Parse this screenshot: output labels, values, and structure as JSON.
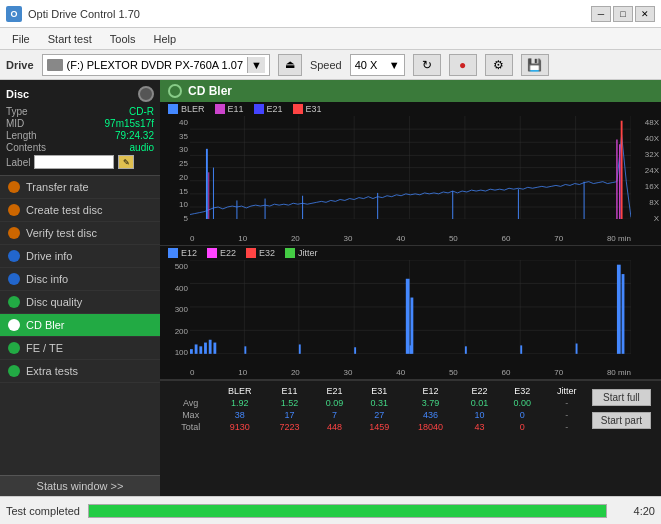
{
  "titlebar": {
    "title": "Opti Drive Control 1.70",
    "icon_label": "O",
    "minimize": "─",
    "maximize": "□",
    "close": "✕"
  },
  "menubar": {
    "items": [
      "File",
      "Start test",
      "Tools",
      "Help"
    ]
  },
  "drivebar": {
    "label": "Drive",
    "drive_text": "(F:)  PLEXTOR DVDR  PX-760A 1.07",
    "speed_label": "Speed",
    "speed_value": "40 X",
    "dropdown_arrow": "▼"
  },
  "disc": {
    "title": "Disc",
    "type_label": "Type",
    "type_value": "CD-R",
    "mid_label": "MID",
    "mid_value": "97m15s17f",
    "length_label": "Length",
    "length_value": "79:24.32",
    "contents_label": "Contents",
    "contents_value": "audio",
    "label_label": "Label"
  },
  "nav": {
    "items": [
      {
        "id": "transfer-rate",
        "label": "Transfer rate",
        "dot_type": "orange"
      },
      {
        "id": "create-test-disc",
        "label": "Create test disc",
        "dot_type": "orange"
      },
      {
        "id": "verify-test-disc",
        "label": "Verify test disc",
        "dot_type": "orange"
      },
      {
        "id": "drive-info",
        "label": "Drive info",
        "dot_type": "blue"
      },
      {
        "id": "disc-info",
        "label": "Disc info",
        "dot_type": "blue"
      },
      {
        "id": "disc-quality",
        "label": "Disc quality",
        "dot_type": "green"
      },
      {
        "id": "cd-bler",
        "label": "CD Bler",
        "dot_type": "active",
        "active": true
      },
      {
        "id": "fe-te",
        "label": "FE / TE",
        "dot_type": "green"
      },
      {
        "id": "extra-tests",
        "label": "Extra tests",
        "dot_type": "green"
      }
    ],
    "status_btn": "Status window >>"
  },
  "chart": {
    "title": "CD Bler",
    "legend1": [
      {
        "label": "BLER",
        "color": "#4488ff"
      },
      {
        "label": "E11",
        "color": "#cc44cc"
      },
      {
        "label": "E21",
        "color": "#4444ff"
      },
      {
        "label": "E31",
        "color": "#ff4444"
      }
    ],
    "legend2": [
      {
        "label": "E12",
        "color": "#4488ff"
      },
      {
        "label": "E22",
        "color": "#ff44ff"
      },
      {
        "label": "E32",
        "color": "#ff4444"
      },
      {
        "label": "Jitter",
        "color": "#44cc44"
      }
    ],
    "chart1": {
      "y_max": 40,
      "y_labels": [
        "40",
        "35",
        "30",
        "25",
        "20",
        "15",
        "10",
        "5"
      ],
      "y_right_labels": [
        "48X",
        "40X",
        "32X",
        "24X",
        "16X",
        "8X",
        "X"
      ],
      "x_labels": [
        "0",
        "10",
        "20",
        "30",
        "40",
        "50",
        "60",
        "70",
        "80 min"
      ]
    },
    "chart2": {
      "y_max": 500,
      "y_labels": [
        "500",
        "400",
        "300",
        "200",
        "100"
      ],
      "x_labels": [
        "0",
        "10",
        "20",
        "30",
        "40",
        "50",
        "60",
        "70",
        "80 min"
      ]
    }
  },
  "table": {
    "headers": [
      "",
      "BLER",
      "E11",
      "E21",
      "E31",
      "E12",
      "E22",
      "E32",
      "Jitter"
    ],
    "rows": [
      {
        "label": "Avg",
        "values": [
          "1.92",
          "1.52",
          "0.09",
          "0.31",
          "3.79",
          "0.01",
          "0.00",
          "-"
        ]
      },
      {
        "label": "Max",
        "values": [
          "38",
          "17",
          "7",
          "27",
          "436",
          "10",
          "0",
          "-"
        ]
      },
      {
        "label": "Total",
        "values": [
          "9130",
          "7223",
          "448",
          "1459",
          "18040",
          "43",
          "0",
          "-"
        ]
      }
    ],
    "btn_start_full": "Start full",
    "btn_start_part": "Start part"
  },
  "statusbar": {
    "status_text": "Test completed",
    "progress_pct": 100,
    "time_text": "4:20"
  }
}
